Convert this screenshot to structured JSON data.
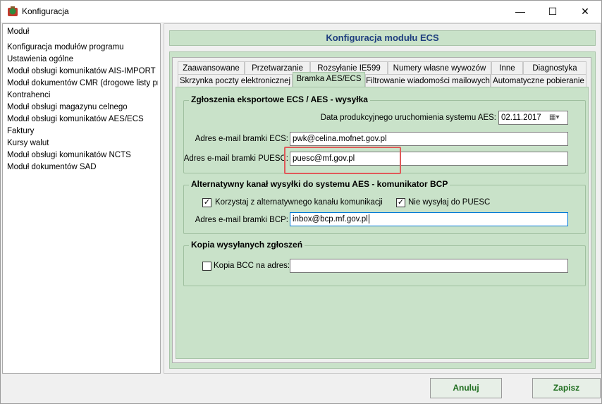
{
  "window": {
    "title": "Konfiguracja",
    "controls": {
      "minimize": "—",
      "maximize": "☐",
      "close": "✕"
    }
  },
  "sidebar": {
    "items": [
      "Moduł",
      "Konfiguracja modułów programu",
      "Ustawienia ogólne",
      "Moduł obsługi komunikatów AIS-IMPORT ...",
      "Moduł dokumentów CMR (drogowe listy pr...",
      "Kontrahenci",
      "Moduł obsługi magazynu celnego",
      "Moduł obsługi komunikatów AES/ECS",
      "Faktury",
      "Kursy walut",
      "Moduł obsługi komunikatów NCTS",
      "Moduł dokumentów SAD"
    ]
  },
  "main": {
    "header": "Konfiguracja modułu ECS",
    "tabs_row1": [
      "Zaawansowane",
      "Przetwarzanie",
      "Rozsyłanie IE599",
      "Numery własne wywozów",
      "Inne",
      "Diagnostyka"
    ],
    "tabs_row2": [
      "Skrzynka poczty elektronicznej",
      "Bramka AES/ECS",
      "Filtrowanie wiadomości mailowych",
      "Automatyczne pobieranie"
    ],
    "active_tab": "Bramka AES/ECS",
    "group1": {
      "legend": "Zgłoszenia eksportowe ECS / AES - wysyłka",
      "date_label": "Data produkcyjnego uruchomienia systemu AES:",
      "date_value": "02.11.2017",
      "ecs_label": "Adres e-mail bramki ECS:",
      "ecs_value": "pwk@celina.mofnet.gov.pl",
      "puesc_label": "Adres e-mail bramki PUESC:",
      "puesc_value": "puesc@mf.gov.pl"
    },
    "group2": {
      "legend": "Alternatywny kanał wysyłki do systemu AES - komunikator BCP",
      "alt_channel_label": "Korzystaj z alternatywnego kanału komunikacji",
      "alt_channel_checked": true,
      "no_puesc_label": "Nie wysyłaj do PUESC",
      "no_puesc_checked": true,
      "bcp_label": "Adres e-mail bramki BCP:",
      "bcp_value": "inbox@bcp.mf.gov.pl"
    },
    "group3": {
      "legend": "Kopia wysyłanych zgłoszeń",
      "bcc_label": "Kopia BCC na adres:",
      "bcc_checked": false,
      "bcc_value": ""
    },
    "check_mark": "✓"
  },
  "footer": {
    "cancel": "Anuluj",
    "save": "Zapisz"
  },
  "colors": {
    "panel_green": "#c9e2c9",
    "header_text": "#1f3f7f",
    "button_text": "#1f6e1f",
    "highlight": "#e05a5a"
  }
}
